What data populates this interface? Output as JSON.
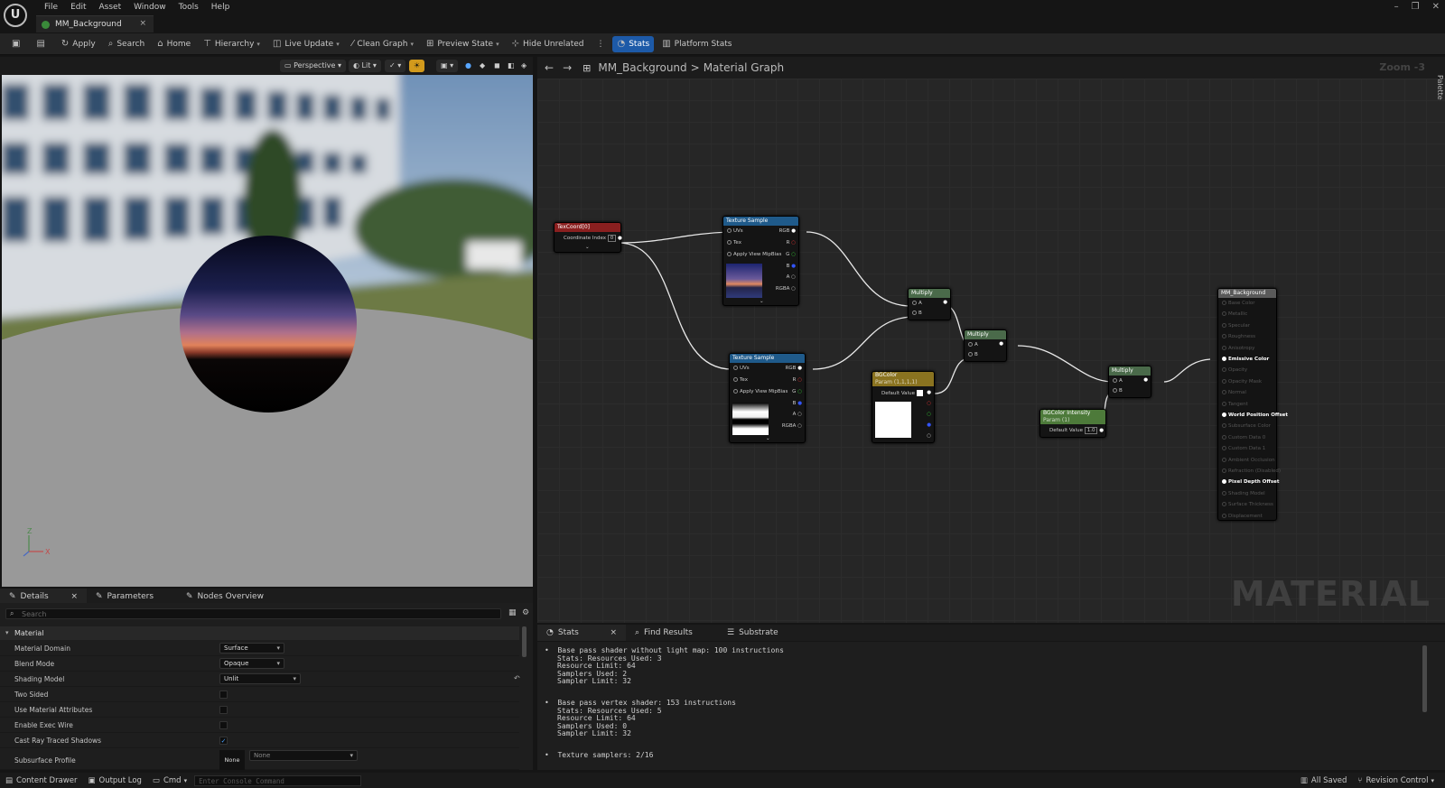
{
  "menu": [
    "File",
    "Edit",
    "Asset",
    "Window",
    "Tools",
    "Help"
  ],
  "doc_tab": "MM_Background",
  "toolbar": {
    "apply": "Apply",
    "search": "Search",
    "home": "Home",
    "hierarchy": "Hierarchy",
    "live_update": "Live Update",
    "clean_graph": "Clean Graph",
    "preview_state": "Preview State",
    "hide_unrelated": "Hide Unrelated",
    "stats": "Stats",
    "platform_stats": "Platform Stats"
  },
  "viewport": {
    "perspective": "Perspective",
    "lit": "Lit",
    "axis_x": "X",
    "axis_z": "Z"
  },
  "graph": {
    "breadcrumb_root": "MM_Background",
    "breadcrumb_sep": ">",
    "breadcrumb_leaf": "Material Graph",
    "zoom": "Zoom -3",
    "palette": "Palette",
    "watermark": "MATERIAL"
  },
  "nodes": {
    "texcoord": {
      "title": "TexCoord[0]",
      "pin": "Coordinate Index",
      "value": "0"
    },
    "tex1": {
      "title": "Texture Sample",
      "pins": [
        "UVs",
        "Tex",
        "Apply View MipBias"
      ],
      "outs": [
        "RGB",
        "R",
        "G",
        "B",
        "A",
        "RGBA"
      ]
    },
    "tex2": {
      "title": "Texture Sample",
      "pins": [
        "UVs",
        "Tex",
        "Apply View MipBias"
      ],
      "outs": [
        "RGB",
        "R",
        "G",
        "B",
        "A",
        "RGBA"
      ]
    },
    "mul1": {
      "title": "Multiply",
      "a": "A",
      "b": "B"
    },
    "mul2": {
      "title": "Multiply",
      "a": "A",
      "b": "B"
    },
    "mul3": {
      "title": "Multiply",
      "a": "A",
      "b": "B"
    },
    "bgcolor": {
      "title": "BGColor",
      "sub": "Param (1,1,1,1)",
      "pin": "Default Value"
    },
    "intensity": {
      "title": "BGColor Intensity",
      "sub": "Param (1)",
      "pin": "Default Value",
      "value": "1.0"
    },
    "result": {
      "title": "MM_Background",
      "pins": [
        "Base Color",
        "Metallic",
        "Specular",
        "Roughness",
        "Anisotropy",
        "Emissive Color",
        "Opacity",
        "Opacity Mask",
        "Normal",
        "Tangent",
        "World Position Offset",
        "Subsurface Color",
        "Custom Data 0",
        "Custom Data 1",
        "Ambient Occlusion",
        "Refraction (Disabled)",
        "Pixel Depth Offset",
        "Shading Model",
        "Surface Thickness",
        "Displacement"
      ],
      "active": [
        5,
        10,
        16
      ]
    }
  },
  "details_tabs": {
    "details": "Details",
    "parameters": "Parameters",
    "nodes_overview": "Nodes Overview"
  },
  "details": {
    "search_placeholder": "Search",
    "section": "Material",
    "rows": [
      {
        "label": "Material Domain",
        "value": "Surface"
      },
      {
        "label": "Blend Mode",
        "value": "Opaque"
      },
      {
        "label": "Shading Model",
        "value": "Unlit"
      },
      {
        "label": "Two Sided",
        "value": ""
      },
      {
        "label": "Use Material Attributes",
        "value": ""
      },
      {
        "label": "Enable Exec Wire",
        "value": ""
      },
      {
        "label": "Cast Ray Traced Shadows",
        "value": "✓"
      },
      {
        "label": "Subsurface Profile",
        "value": "None"
      }
    ],
    "subsurface_none": "None"
  },
  "stats_tabs": {
    "stats": "Stats",
    "find_results": "Find Results",
    "substrate": "Substrate"
  },
  "stats": {
    "block1": {
      "title": "Base pass shader without light map: 100 instructions",
      "lines": [
        "Stats: Resources Used: 3",
        "Resource Limit: 64",
        "Samplers Used: 2",
        "Sampler Limit: 32"
      ]
    },
    "block2": {
      "title": "Base pass vertex shader: 153 instructions",
      "lines": [
        "Stats: Resources Used: 5",
        "Resource Limit: 64",
        "Samplers Used: 0",
        "Sampler Limit: 32"
      ]
    },
    "block3": {
      "title": "Texture samplers: 2/16"
    }
  },
  "statusbar": {
    "content_drawer": "Content Drawer",
    "output_log": "Output Log",
    "cmd": "Cmd",
    "console_placeholder": "Enter Console Command",
    "all_saved": "All Saved",
    "revision_control": "Revision Control"
  }
}
